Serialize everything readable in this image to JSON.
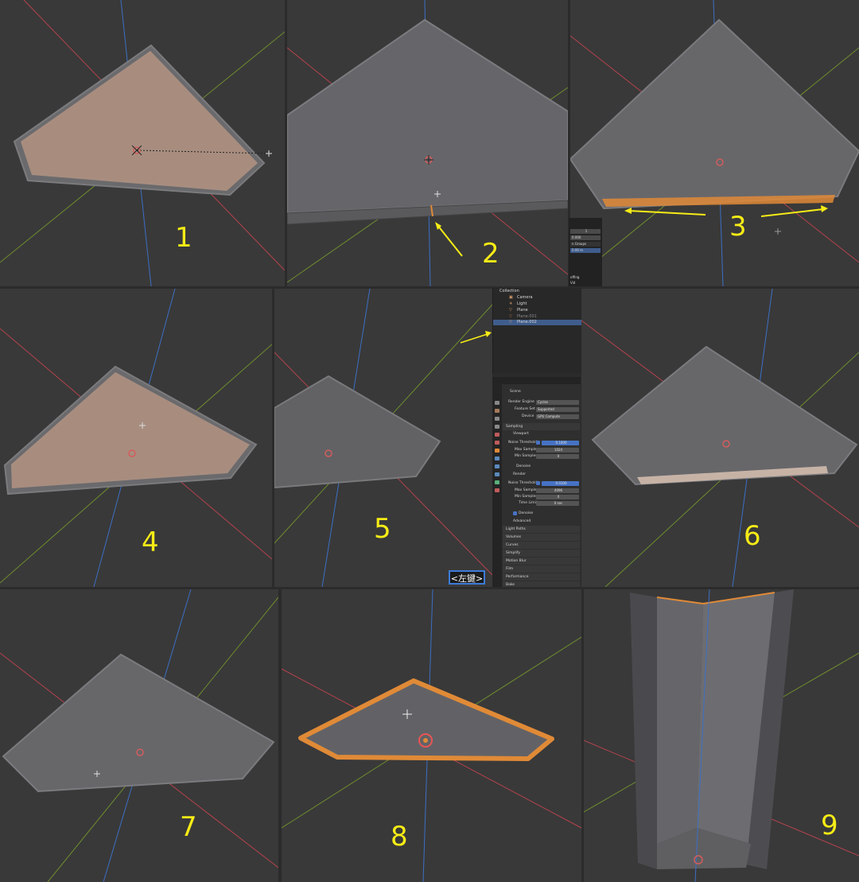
{
  "steps": [
    "1",
    "2",
    "3",
    "4",
    "5",
    "6",
    "7",
    "8",
    "9"
  ],
  "colors": {
    "step_label": "#f7ec16",
    "viewport_bg": "#393939",
    "axis_x": "#b5424c",
    "axis_y": "#6f8d2e",
    "axis_z": "#3d6fc4",
    "face_selected": "#a88d7f",
    "face": "#5f5f62",
    "edge_selected": "#e08a37",
    "arrow": "#f7ec16"
  },
  "outliner": {
    "collection": "Collection",
    "items": [
      "Camera",
      "Light",
      "Plane",
      "Plane.001",
      "Plane.002"
    ]
  },
  "properties": {
    "scene_label": "Scene",
    "render_engine_label": "Render Engine",
    "render_engine_value": "Cycles",
    "feature_set_label": "Feature Set",
    "feature_set_value": "Supported",
    "device_label": "Device",
    "device_value": "GPU Compute",
    "sampling": "Sampling",
    "viewport": "Viewport",
    "noise_threshold_label": "Noise Threshold",
    "viewport_noise_threshold": "0.1000",
    "max_samples_label": "Max Samples",
    "viewport_max_samples": "1024",
    "min_samples_label": "Min Samples",
    "viewport_min_samples": "0",
    "denoise": "Denoise",
    "render": "Render",
    "render_noise_threshold": "0.0100",
    "render_max_samples": "4096",
    "render_min_samples": "0",
    "time_limit_label": "Time Limit",
    "time_limit_value": "0 sec",
    "render_denoise": "Denoise",
    "advanced": "Advanced",
    "light_paths": "Light Paths",
    "volumes": "Volumes",
    "curves": "Curves",
    "simplify": "Simplify",
    "motion_blur": "Motion Blur",
    "film": "Film",
    "performance": "Performance",
    "bake": "Bake"
  },
  "key_hint": "<左键>",
  "n_panel": {
    "field1": "1",
    "field2": "0.000",
    "field3": "n Groups",
    "field4": "0.00 m",
    "text1": "offing",
    "text2": "Vid"
  }
}
